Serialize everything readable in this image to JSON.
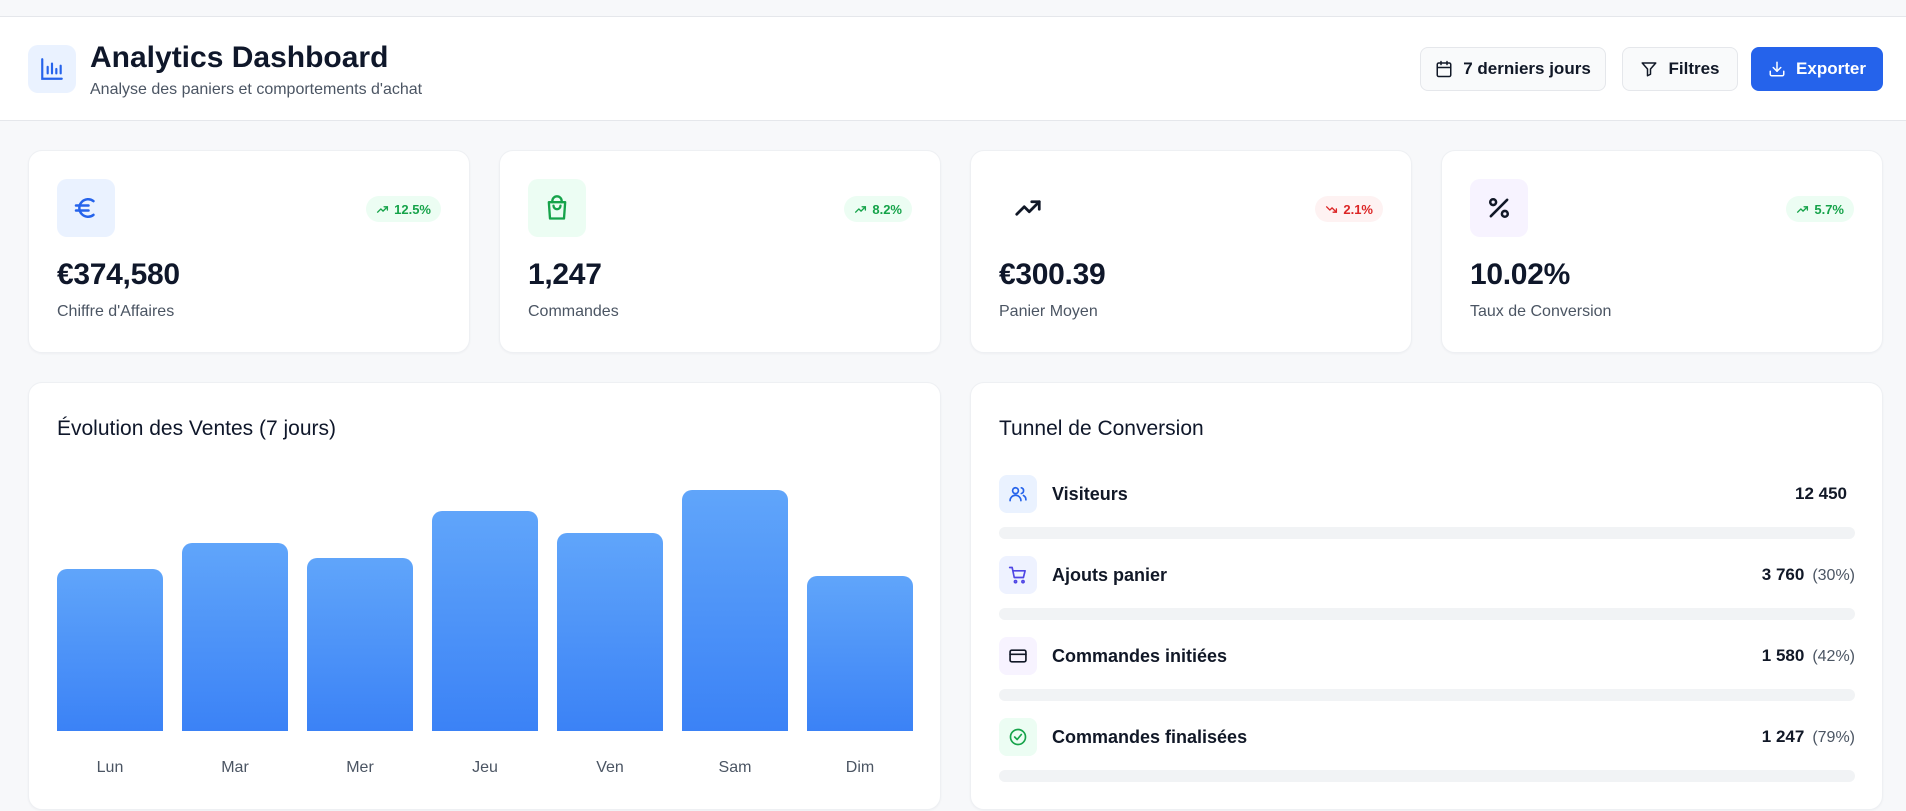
{
  "header": {
    "title": "Analytics Dashboard",
    "subtitle": "Analyse des paniers et comportements d'achat",
    "date_range_label": "7 derniers jours",
    "filters_label": "Filtres",
    "export_label": "Exporter"
  },
  "kpis": [
    {
      "value": "€374,580",
      "label": "Chiffre d'Affaires",
      "trend": "12.5%",
      "direction": "up",
      "icon": "euro-icon",
      "icon_color": "#2563eb",
      "icon_bg": "#eaf2ff"
    },
    {
      "value": "1,247",
      "label": "Commandes",
      "trend": "8.2%",
      "direction": "up",
      "icon": "shopping-bag-icon",
      "icon_color": "#16a34a",
      "icon_bg": "#ecfdf3"
    },
    {
      "value": "€300.39",
      "label": "Panier Moyen",
      "trend": "2.1%",
      "direction": "down",
      "icon": "trending-up-icon",
      "icon_color": "#111827",
      "icon_bg": "#ffffff"
    },
    {
      "value": "10.02%",
      "label": "Taux de Conversion",
      "trend": "5.7%",
      "direction": "up",
      "icon": "percent-icon",
      "icon_color": "#111827",
      "icon_bg": "#f7f3ff"
    }
  ],
  "sales": {
    "title": "Évolution des Ventes (7 jours)"
  },
  "chart_data": {
    "type": "bar",
    "categories": [
      "Lun",
      "Mar",
      "Mer",
      "Jeu",
      "Ven",
      "Sam",
      "Dim"
    ],
    "values": [
      162,
      188,
      173,
      220,
      198,
      241,
      155
    ],
    "ylim": [
      0,
      248
    ],
    "title": "Évolution des Ventes (7 jours)",
    "xlabel": "",
    "ylabel": "",
    "grid": false,
    "color": "#3b82f6"
  },
  "funnel": {
    "title": "Tunnel de Conversion",
    "steps": [
      {
        "label": "Visiteurs",
        "count": "12 450",
        "pct": "",
        "icon": "users-icon",
        "icon_color": "#2563eb",
        "icon_bg": "#eaf2ff"
      },
      {
        "label": "Ajouts panier",
        "count": "3 760",
        "pct": "(30%)",
        "icon": "cart-icon",
        "icon_color": "#4f46e5",
        "icon_bg": "#eef2ff"
      },
      {
        "label": "Commandes initiées",
        "count": "1 580",
        "pct": "(42%)",
        "icon": "credit-card-icon",
        "icon_color": "#111827",
        "icon_bg": "#f7f3ff"
      },
      {
        "label": "Commandes finalisées",
        "count": "1 247",
        "pct": "(79%)",
        "icon": "check-circle-icon",
        "icon_color": "#16a34a",
        "icon_bg": "#ecfdf3"
      }
    ]
  },
  "colors": {
    "primary": "#2563eb",
    "positive": "#16a34a",
    "negative": "#dc2626"
  }
}
